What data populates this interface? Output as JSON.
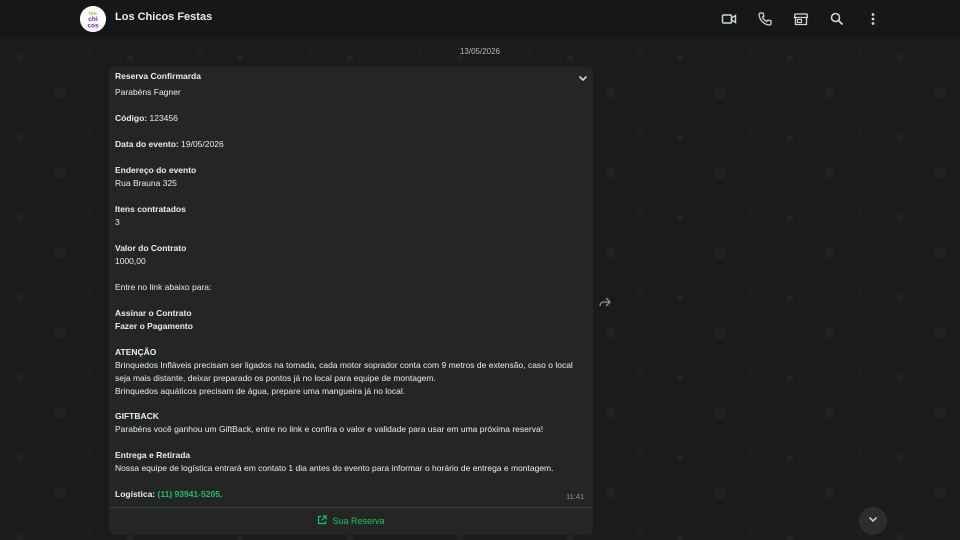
{
  "header": {
    "contact_name": "Los Chicos Festas",
    "avatar_text": [
      "los",
      "chi",
      "cos"
    ],
    "icons": [
      "video-call-icon",
      "voice-call-icon",
      "store-icon",
      "search-icon",
      "menu-icon"
    ]
  },
  "chat": {
    "date": "13/05/2026",
    "message": {
      "title": "Reserva Confirmarda",
      "greeting": "Parabéns Fagner",
      "code_label": "Código:",
      "code_value": "123456",
      "event_date_label": "Data do evento:",
      "event_date_value": "19/05/2026",
      "address_label": "Endereço do evento",
      "address_value": "Rua Brauna 325",
      "items_label": "Itens contratados",
      "items_value": "3",
      "contract_value_label": "Valor do Contrato",
      "contract_value": "1000,00",
      "link_intro": "Entre no link abaixo para:",
      "action_sign": "Assinar o Contrato",
      "action_pay": "Fazer o Pagamento",
      "attention_label": "ATENÇÃO",
      "attention_text": "Brinquedos Infláveis precisam ser ligados na tomada, cada motor soprador conta com 9 metros de extensão, caso o local seja mais distante, deixar preparado os pontos já no local para equipe de montagem.",
      "attention_text_2": "Brinquedos aquáticos precisam de água, prepare uma mangueira já no local.",
      "giftback_label": "GIFTBACK",
      "giftback_text": "Parabéns você ganhou um GiftBack, entre no link e confira o valor e validade para usar em uma próxima reserva!",
      "delivery_label": "Entrega e Retirada",
      "delivery_text": "Nossa equipe de logística entrará em contato 1 dia antes do evento para informar o horário de entrega e montagem.",
      "logistics_label": "Logística:",
      "logistics_phone": "(11) 93941-5205",
      "logistics_suffix": ".",
      "time": "11:41",
      "button_label": "Sua Reserva"
    }
  },
  "colors": {
    "accent": "#21c063",
    "bubble": "#242626",
    "header": "#161717"
  }
}
